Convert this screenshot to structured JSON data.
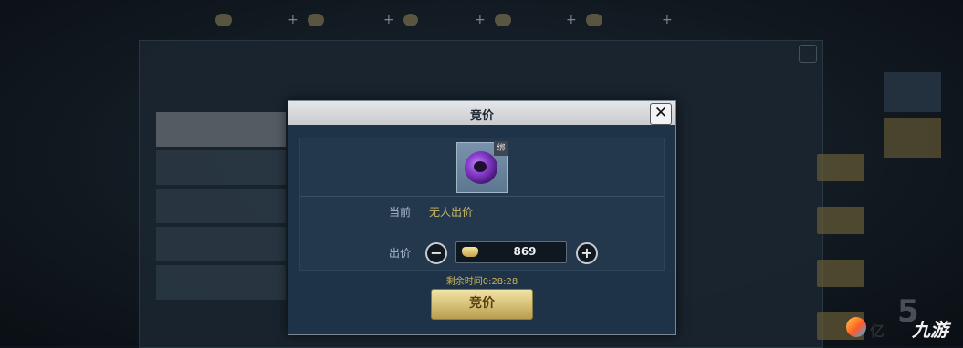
{
  "dialog": {
    "title": "竞价",
    "close_symbol": "✕",
    "item_bind_tag": "绑",
    "current_label": "当前",
    "current_value": "无人出价",
    "bid_label": "出价",
    "minus_symbol": "−",
    "plus_symbol": "+",
    "bid_amount": "869",
    "time_remaining": "剩余时间0:28:28",
    "bid_button_label": "竞价"
  },
  "watermark": {
    "digit": "5",
    "text_left": "亿",
    "text_right": "九游"
  },
  "icons": [
    "close-icon",
    "minus-icon",
    "plus-icon",
    "gold-ingot-icon",
    "purple-gem-item-icon"
  ],
  "colors": {
    "bid_button": "#d7c278",
    "dialog_bg": "#1e3348",
    "value_gold": "#cbb866"
  }
}
